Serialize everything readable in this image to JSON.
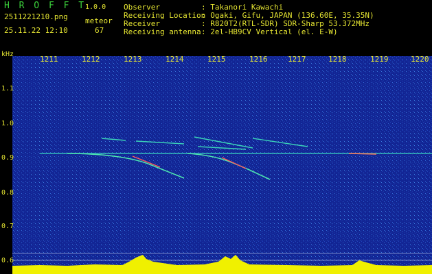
{
  "header": {
    "logo": "H R O F F T",
    "version": "1.0.0",
    "filename": "2511221210.png",
    "meteor_label": "meteor",
    "datetime": "25.11.22 12:10",
    "meteor_count": "67"
  },
  "info": {
    "observer_label": "Observer",
    "observer_value": ": Takanori Kawachi",
    "location_label": "Receiving Location",
    "location_value": ": Ogaki, Gifu, JAPAN (136.60E, 35.35N)",
    "receiver_label": "Receiver",
    "receiver_value": ": R820T2(RTL-SDR) SDR-Sharp 53.372MHz",
    "antenna_label": "Receiving antenna",
    "antenna_value": ": 2el-HB9CV Vertical (el. E-W)"
  },
  "axis": {
    "unit": "kHz",
    "time_ticks": [
      "1211",
      "1212",
      "1213",
      "1214",
      "1215",
      "1216",
      "1217",
      "1218",
      "1219",
      "1220"
    ],
    "freq_ticks": [
      "1.1",
      "1.0",
      "0.9",
      "0.8",
      "0.7",
      "0.6"
    ]
  },
  "colors": {
    "background": "#000000",
    "plot_background": "#0b1a8a",
    "label_green": "#3cd23c",
    "label_yellow": "#e6e632",
    "signal": "#3ce6b4",
    "histogram": "#f0f000",
    "baseline": "#00c8ff"
  }
}
